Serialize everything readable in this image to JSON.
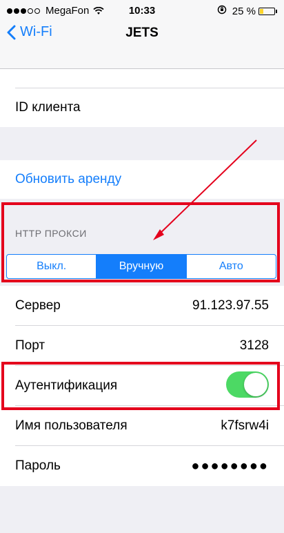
{
  "status_bar": {
    "carrier": "MegaFon",
    "time": "10:33",
    "battery_percent": "25 %"
  },
  "nav": {
    "back_label": "Wi-Fi",
    "title": "JETS"
  },
  "rows": {
    "client_id_label": "ID клиента",
    "renew_lease_label": "Обновить аренду"
  },
  "http_proxy": {
    "header": "HTTP ПРОКСИ",
    "segments": [
      "Выкл.",
      "Вручную",
      "Авто"
    ],
    "selected_index": 1
  },
  "proxy_fields": {
    "server_label": "Сервер",
    "server_value": "91.123.97.55",
    "port_label": "Порт",
    "port_value": "3128",
    "auth_label": "Аутентификация",
    "auth_enabled": true,
    "username_label": "Имя пользователя",
    "username_value": "k7fsrw4i",
    "password_label": "Пароль",
    "password_value": "●●●●●●●●"
  },
  "colors": {
    "ios_blue": "#147efb",
    "toggle_green": "#4cd964",
    "annotation_red": "#e4001c",
    "battery_yellow": "#ffd42a"
  }
}
